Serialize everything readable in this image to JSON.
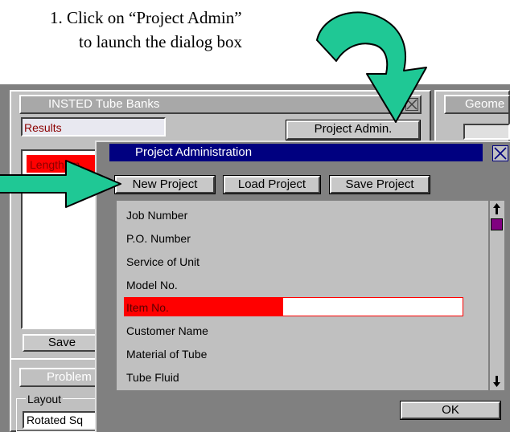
{
  "instruction": {
    "line1": "1. Click on “Project Admin”",
    "line2": "to launch the dialog box"
  },
  "colors": {
    "arrow": "#1fc895",
    "titlebar": "#000080",
    "highlight": "#ff0000",
    "scroll_thumb": "#800080",
    "panel_bg": "#c0c0c0"
  },
  "main_window": {
    "title": "INSTED Tube Banks",
    "results_label": "Results",
    "project_admin_button": "Project Admin.",
    "length_label": "Length, m",
    "save_button": "Save",
    "problem_title": "Problem",
    "layout_label": "Layout",
    "layout_value": "Rotated Sq"
  },
  "geometry_window": {
    "title": "Geome"
  },
  "dialog": {
    "title": "Project Administration",
    "close_icon": "close-icon",
    "buttons": {
      "new": "New Project",
      "load": "Load Project",
      "save": "Save Project",
      "ok": "OK"
    },
    "fields": [
      "Job Number",
      "P.O. Number",
      "Service of Unit",
      "Model No.",
      "Item No.",
      "Customer Name",
      "Material of Tube",
      "Tube Fluid"
    ],
    "selected_field_index": 4
  }
}
